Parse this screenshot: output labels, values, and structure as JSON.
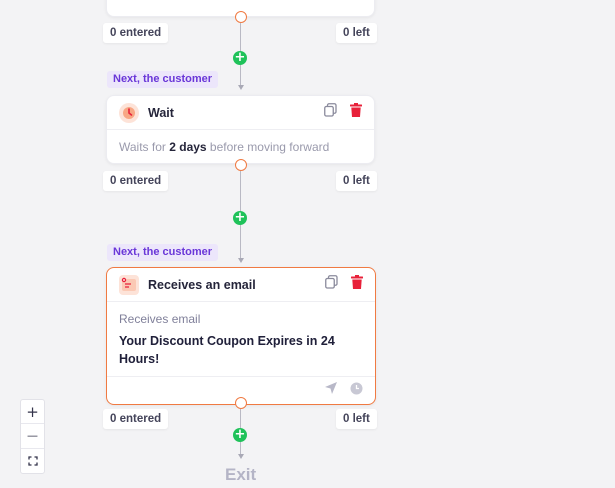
{
  "connector_label": "Next, the customer",
  "add_symbol": "+",
  "top_node": {
    "entered": "0 entered",
    "left": "0 left"
  },
  "wait_node": {
    "label": "Next, the customer",
    "title": "Wait",
    "body_prefix": "Waits for ",
    "body_duration": "2 days",
    "body_suffix": " before moving forward",
    "entered": "0 entered",
    "left": "0 left"
  },
  "email_node": {
    "label": "Next, the customer",
    "title": "Receives an email",
    "body_label": "Receives email",
    "subject": "Your Discount Coupon Expires in 24 Hours!",
    "entered": "0 entered",
    "left": "0 left"
  },
  "exit_label": "Exit",
  "zoom": {
    "in": "+",
    "out": "—",
    "fit": "⛶"
  },
  "colors": {
    "accent": "#f07a42",
    "add": "#1fc25a",
    "label_bg": "#ece6fb",
    "label_text": "#6a37d8",
    "delete": "#e8213a"
  }
}
